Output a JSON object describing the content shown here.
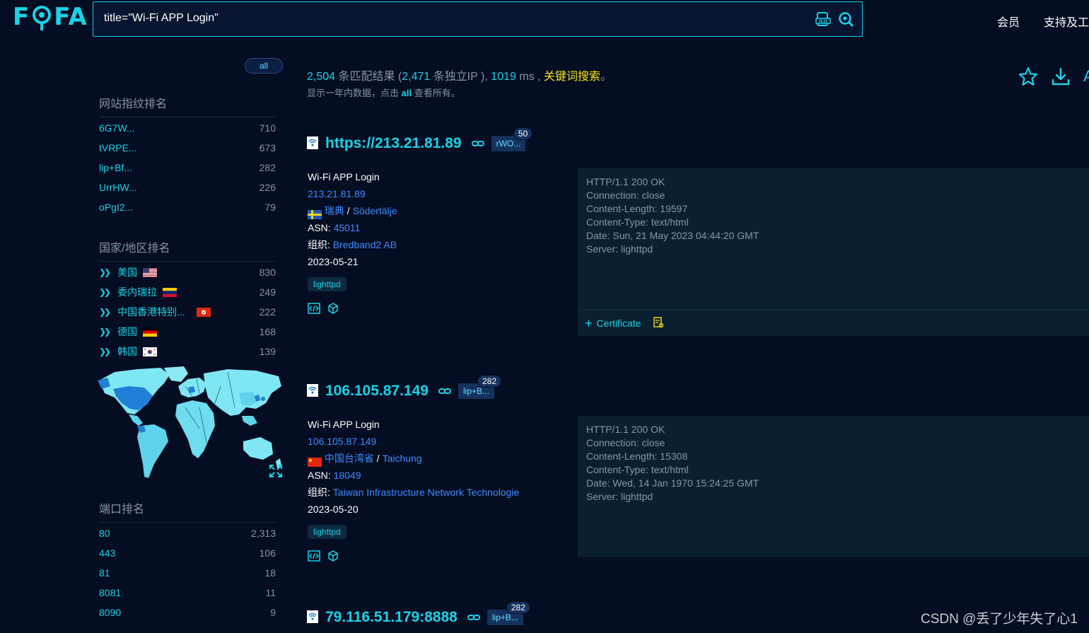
{
  "header": {
    "logo": "FOFA",
    "search_query": "title=\"Wi-Fi APP Login\"",
    "nav": [
      "会员",
      "支持及工"
    ],
    "icons": [
      "ico-search-icon",
      "search-icon"
    ]
  },
  "sidebar": {
    "all_label": "all",
    "fingerprint_title": "网站指纹排名",
    "fingerprints": [
      {
        "name": "6G7W...",
        "count": "710"
      },
      {
        "name": "tVRPE...",
        "count": "673"
      },
      {
        "name": "lip+Bf...",
        "count": "282"
      },
      {
        "name": "UrrHW...",
        "count": "226"
      },
      {
        "name": "oPgI2...",
        "count": "79"
      }
    ],
    "country_title": "国家/地区排名",
    "countries": [
      {
        "name": "美国",
        "count": "830",
        "flag": "us"
      },
      {
        "name": "委内瑞拉",
        "count": "249",
        "flag": "ve"
      },
      {
        "name": "中国香港特别...",
        "count": "222",
        "flag": "hk"
      },
      {
        "name": "德国",
        "count": "168",
        "flag": "de"
      },
      {
        "name": "韩国",
        "count": "139",
        "flag": "kr"
      }
    ],
    "port_title": "端口排名",
    "ports": [
      {
        "name": "80",
        "count": "2,313"
      },
      {
        "name": "443",
        "count": "106"
      },
      {
        "name": "81",
        "count": "18"
      },
      {
        "name": "8081",
        "count": "11"
      },
      {
        "name": "8090",
        "count": "9"
      }
    ]
  },
  "stats": {
    "total": "2,504",
    "total_label": "条匹配结果 (",
    "ips": "2,471",
    "ips_label": "条独立IP ),",
    "ms": "1019",
    "ms_label": "ms ,",
    "keyword": "关键词搜索",
    "end": "。",
    "sub_prefix": "显示一年内数据，点击",
    "sub_all": "all",
    "sub_suffix": "查看所有。"
  },
  "results": [
    {
      "host": "https://213.21.81.89",
      "tag": "rWO...",
      "tag_count": "50",
      "title": "Wi-Fi APP Login",
      "ip": "213.21.81.89",
      "country": "瑞典",
      "city": "Södertälje",
      "flag": "se",
      "asn_label": "ASN:",
      "asn": "45011",
      "org_label": "组织:",
      "org": "Bredband2 AB",
      "date": "2023-05-21",
      "server": "lighttpd",
      "response": "HTTP/1.1 200 OK\nConnection: close\nContent-Length: 19597\nContent-Type: text/html\nDate: Sun, 21 May 2023 04:44:20 GMT\nServer: lighttpd",
      "cert_label": "Certificate"
    },
    {
      "host": "106.105.87.149",
      "tag": "lip+B...",
      "tag_count": "282",
      "title": "Wi-Fi APP Login",
      "ip": "106.105.87.149",
      "country": "中国台湾省",
      "city": "Taichung",
      "flag": "cn",
      "asn_label": "ASN:",
      "asn": "18049",
      "org_label": "组织:",
      "org": "Taiwan Infrastructure Network Technologie",
      "date": "2023-05-20",
      "server": "lighttpd",
      "response": "HTTP/1.1 200 OK\nConnection: close\nContent-Length: 15308\nContent-Type: text/html\nDate: Wed, 14 Jan 1970 15:24:25 GMT\nServer: lighttpd"
    },
    {
      "host": "79.116.51.179:8888",
      "tag": "lip+B...",
      "tag_count": "282"
    }
  ],
  "watermark": "CSDN @丢了少年失了心1",
  "colors": {
    "accent": "#19d3e6",
    "background": "#040d21",
    "keyword": "#f3e21b",
    "link": "#3d8bff"
  }
}
